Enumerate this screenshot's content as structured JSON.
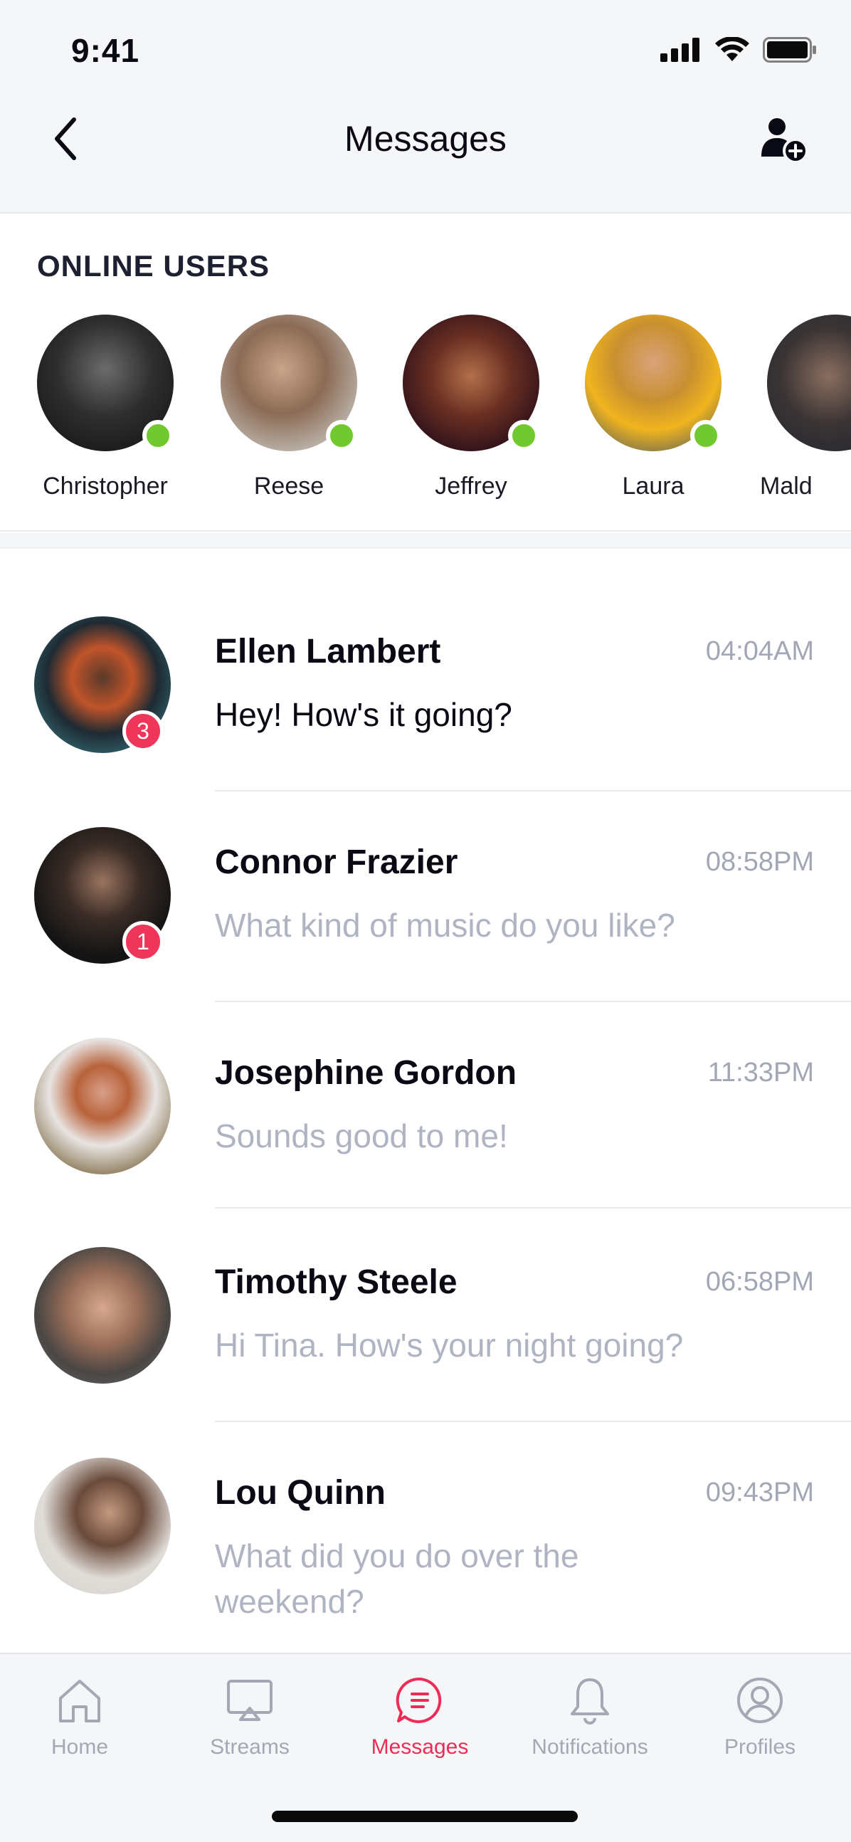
{
  "status_bar": {
    "time": "9:41",
    "icons": [
      "signal-icon",
      "wifi-icon",
      "battery-icon"
    ]
  },
  "nav": {
    "title": "Messages",
    "back_icon": "chevron-left-icon",
    "action_icon": "add-user-icon"
  },
  "online": {
    "title": "ONLINE USERS",
    "users": [
      {
        "name": "Christopher",
        "online": true
      },
      {
        "name": "Reese",
        "online": true
      },
      {
        "name": "Jeffrey",
        "online": true
      },
      {
        "name": "Laura",
        "online": true
      },
      {
        "name": "Mald",
        "online": false
      }
    ]
  },
  "conversations": [
    {
      "name": "Ellen Lambert",
      "time": "04:04AM",
      "message": "Hey! How's it going?",
      "unread": "3"
    },
    {
      "name": "Connor Frazier",
      "time": "08:58PM",
      "message": "What kind of music do you like?",
      "unread": "1"
    },
    {
      "name": "Josephine Gordon",
      "time": "11:33PM",
      "message": "Sounds good to me!",
      "unread": ""
    },
    {
      "name": "Timothy Steele",
      "time": "06:58PM",
      "message": "Hi Tina. How's your night going?",
      "unread": ""
    },
    {
      "name": "Lou Quinn",
      "time": "09:43PM",
      "message": "What did you do over the weekend?",
      "unread": ""
    }
  ],
  "tabs": [
    {
      "label": "Home",
      "icon": "home-icon",
      "active": false
    },
    {
      "label": "Streams",
      "icon": "cast-icon",
      "active": false
    },
    {
      "label": "Messages",
      "icon": "message-icon",
      "active": true
    },
    {
      "label": "Notifications",
      "icon": "bell-icon",
      "active": false
    },
    {
      "label": "Profiles",
      "icon": "profile-icon",
      "active": false
    }
  ],
  "colors": {
    "accent": "#ee2c58",
    "online": "#72c92f",
    "badge": "#f0355a",
    "muted": "#b0b4c2"
  }
}
